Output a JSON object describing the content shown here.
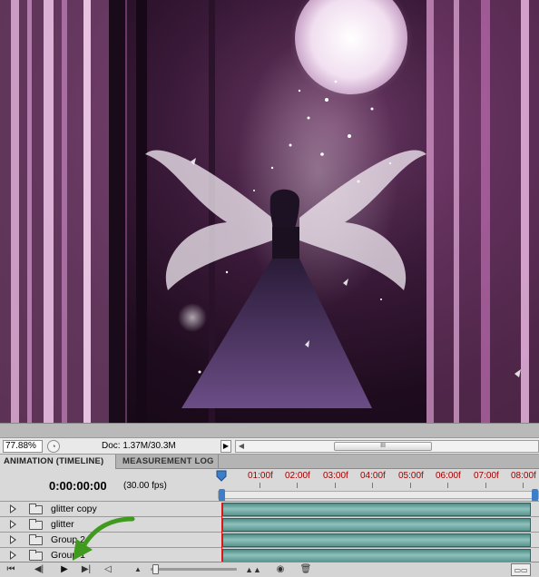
{
  "canvas": {
    "image_alt": "fairy-forest-artwork"
  },
  "status_bar": {
    "zoom": "77.88%",
    "doc_info": "Doc: 1.37M/30.3M",
    "scroll_thumb": "III"
  },
  "panel_tabs": {
    "animation": "ANIMATION (TIMELINE)",
    "measurement": "MEASUREMENT LOG"
  },
  "timeline": {
    "timecode": "0:00:00:00",
    "fps": "(30.00 fps)",
    "ruler": [
      "01:00f",
      "02:00f",
      "03:00f",
      "04:00f",
      "05:00f",
      "06:00f",
      "07:00f",
      "08:00f"
    ],
    "layers": [
      {
        "name": "glitter copy"
      },
      {
        "name": "glitter"
      },
      {
        "name": "Group 2"
      },
      {
        "name": "Group 1"
      }
    ]
  },
  "colors": {
    "track": "#6fa8a2",
    "playhead": "#e01010",
    "ruler_labels": "#a00000",
    "annotation_arrow": "#3f9a1e"
  }
}
